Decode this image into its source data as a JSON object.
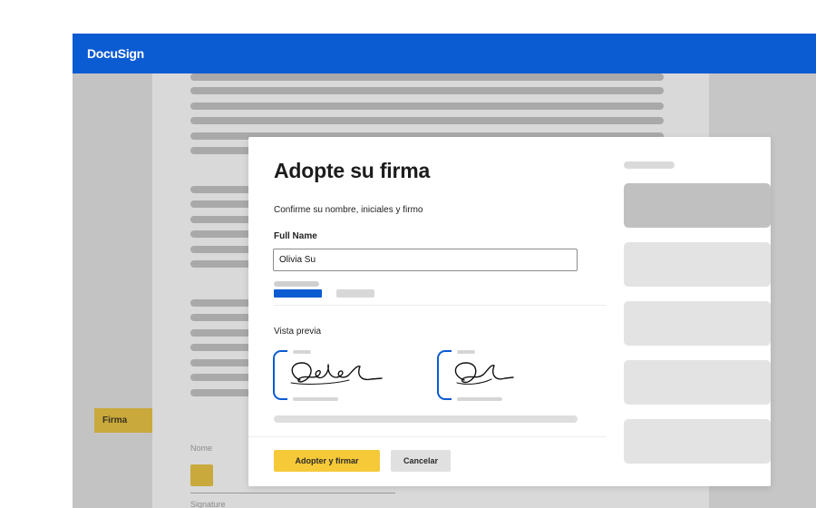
{
  "app": {
    "logo": "DocuSign",
    "brand_color": "#0b5bd3"
  },
  "document": {
    "sign_tag": "Firma",
    "name_label": "Nome",
    "signature_label": "Signature"
  },
  "modal": {
    "title": "Adopte su firma",
    "subtitle": "Confirme su nombre, iniciales y firmo",
    "full_name_label": "Full Name",
    "full_name_value": "Olivia Su",
    "preview_label": "Vista previa",
    "adopt_button": "Adopter y firmar",
    "cancel_button": "Cancelar",
    "accent_color": "#f6c938",
    "signature_icon": "handwritten-signature-icon",
    "initials_icon": "handwritten-initials-icon"
  }
}
